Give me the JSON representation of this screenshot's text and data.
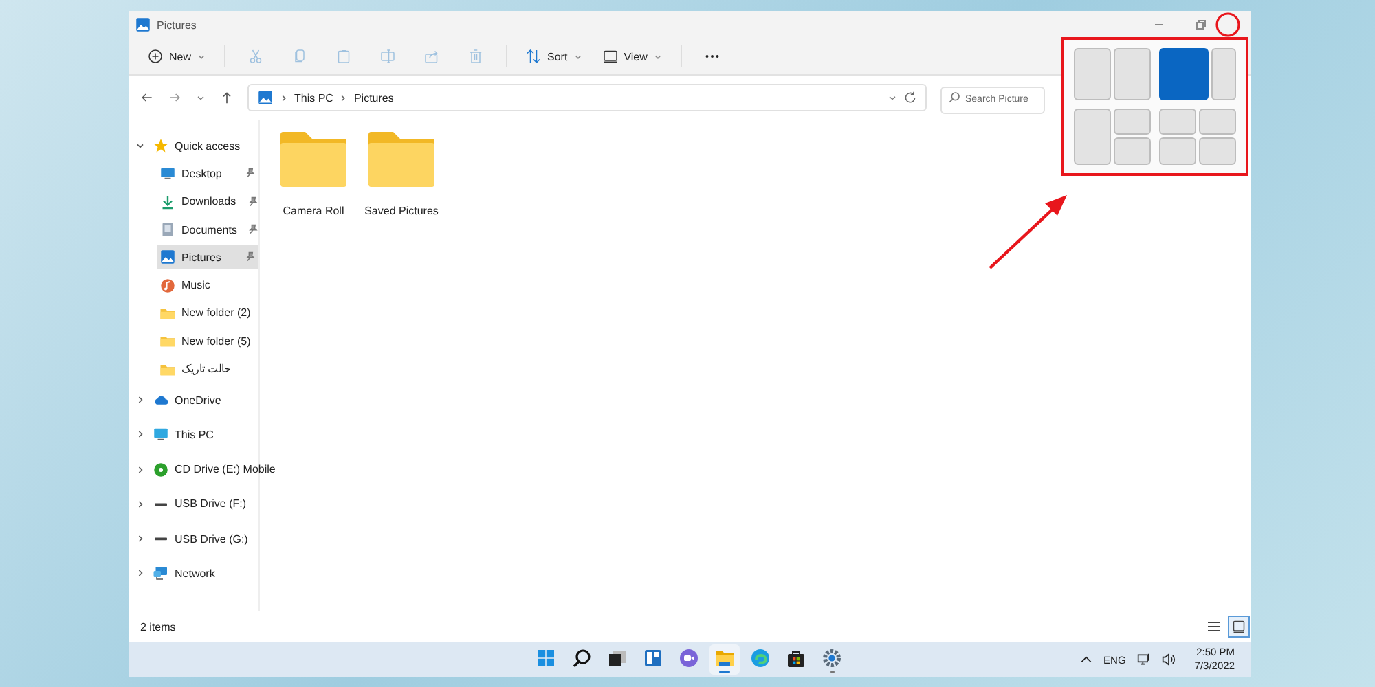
{
  "window": {
    "title": "Pictures"
  },
  "toolbar": {
    "new_label": "New",
    "actions": [
      {
        "kind": "cut",
        "disabled": true
      },
      {
        "kind": "copy",
        "disabled": true
      },
      {
        "kind": "paste",
        "disabled": true
      },
      {
        "kind": "rename",
        "disabled": true
      },
      {
        "kind": "share",
        "disabled": true
      },
      {
        "kind": "delete",
        "disabled": true
      }
    ],
    "sort_label": "Sort",
    "view_label": "View"
  },
  "address": {
    "path": [
      "This PC",
      "Pictures"
    ],
    "search_placeholder": "Search Picture"
  },
  "sidebar": {
    "items": [
      {
        "label": "Quick access",
        "kind": "star",
        "expanded": true,
        "selected": false,
        "children": [
          {
            "label": "Desktop",
            "kind": "desktop",
            "pinned": true,
            "selected": false
          },
          {
            "label": "Downloads",
            "kind": "download",
            "pinned": true,
            "selected": false
          },
          {
            "label": "Documents",
            "kind": "documents",
            "pinned": true,
            "selected": false
          },
          {
            "label": "Pictures",
            "kind": "pictures",
            "pinned": true,
            "selected": true
          },
          {
            "label": "Music",
            "kind": "music",
            "pinned": false,
            "selected": false
          },
          {
            "label": "New folder (2)",
            "kind": "folder",
            "pinned": false,
            "selected": false
          },
          {
            "label": "New folder (5)",
            "kind": "folder",
            "pinned": false,
            "selected": false
          },
          {
            "label": "حالت تاریک",
            "kind": "folder",
            "pinned": false,
            "selected": false
          }
        ]
      },
      {
        "label": "OneDrive",
        "kind": "cloud",
        "expanded": false,
        "selected": false
      },
      {
        "label": "This PC",
        "kind": "pc",
        "expanded": false,
        "selected": false
      },
      {
        "label": "CD Drive (E:) Mobile",
        "kind": "cd",
        "expanded": false,
        "selected": false
      },
      {
        "label": "USB Drive (F:)",
        "kind": "usb",
        "expanded": false,
        "selected": false
      },
      {
        "label": "USB Drive (G:)",
        "kind": "usb",
        "expanded": false,
        "selected": false
      },
      {
        "label": "Network",
        "kind": "network",
        "expanded": false,
        "selected": false
      }
    ]
  },
  "files": [
    {
      "name": "Camera Roll"
    },
    {
      "name": "Saved Pictures"
    }
  ],
  "status_bar": {
    "count": "2 items",
    "views": [
      {
        "kind": "details",
        "selected": false
      },
      {
        "kind": "large-icons",
        "selected": true
      }
    ]
  },
  "snap_layouts": [
    {
      "kind": "halves",
      "zones": [
        {
          "selected": false
        },
        {
          "selected": false
        }
      ]
    },
    {
      "kind": "wide-narrow",
      "zones": [
        {
          "selected": true
        },
        {
          "selected": false
        }
      ]
    },
    {
      "kind": "left-stack",
      "zones": [
        {
          "selected": false
        },
        {
          "selected": false
        },
        {
          "selected": false
        }
      ]
    },
    {
      "kind": "quarters",
      "zones": [
        {
          "selected": false
        },
        {
          "selected": false
        },
        {
          "selected": false
        },
        {
          "selected": false
        }
      ]
    }
  ],
  "taskbar": {
    "apps": [
      {
        "kind": "start",
        "selected": false,
        "running": false
      },
      {
        "kind": "search",
        "selected": false,
        "running": false
      },
      {
        "kind": "task-view",
        "selected": false,
        "running": false
      },
      {
        "kind": "widgets",
        "selected": false,
        "running": false
      },
      {
        "kind": "chat",
        "selected": false,
        "running": false
      },
      {
        "kind": "explorer",
        "selected": true,
        "running": true
      },
      {
        "kind": "edge",
        "selected": false,
        "running": false
      },
      {
        "kind": "store",
        "selected": false,
        "running": false
      },
      {
        "kind": "settings",
        "selected": false,
        "running": true
      }
    ],
    "language": "ENG",
    "time": "2:50 PM",
    "date": "7/3/2022"
  }
}
